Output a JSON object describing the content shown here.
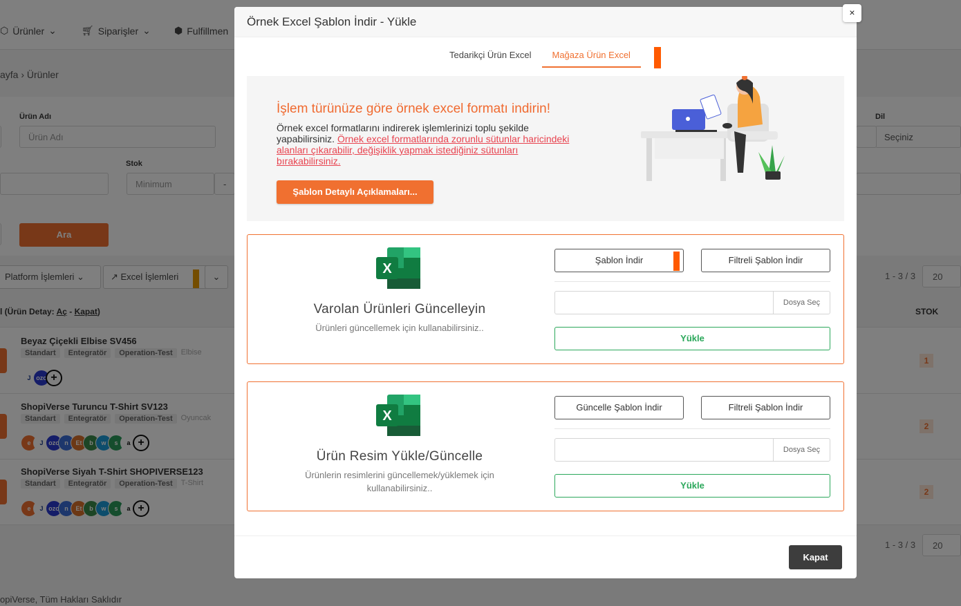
{
  "background": {
    "nav": {
      "products": "Ürünler",
      "orders": "Siparişler",
      "fulfillment": "Fulfillmen"
    },
    "breadcrumb": "ayfa  ›  Ürünler",
    "filters": {
      "product_name_label": "Ürün Adı",
      "product_name_placeholder": "Ürün Adı",
      "stock_label": "Stok",
      "stock_min_placeholder": "Minimum",
      "stock_dash": "-",
      "lang_label": "Dil",
      "lang_value": "Seçiniz",
      "search_button": "Ara"
    },
    "toolbar": {
      "platform_ops": "Platform İşlemleri",
      "excel_ops": "Excel İşlemleri",
      "pager_top": "1 - 3 / 3",
      "page_size": "20"
    },
    "table": {
      "head_detail_prefix": "l (Ürün Detay: ",
      "head_open": "Aç",
      "head_dash": " - ",
      "head_close": "Kapat",
      "head_end": ")",
      "head_stock": "STOK",
      "rows": [
        {
          "title": "Beyaz Çiçekli Elbise SV456",
          "tags": [
            "Standart",
            "Entegratör",
            "Operation-Test"
          ],
          "category": "Elbise",
          "stock": "1"
        },
        {
          "title": "ShopiVerse Turuncu T-Shirt SV123",
          "tags": [
            "Standart",
            "Entegratör",
            "Operation-Test"
          ],
          "category": "Oyuncak",
          "stock": "2"
        },
        {
          "title": "ShopiVerse Siyah T-Shirt SHOPIVERSE123",
          "tags": [
            "Standart",
            "Entegratör",
            "Operation-Test"
          ],
          "category": "T-Shirt",
          "stock": "2"
        }
      ]
    },
    "pager_bottom": "1 - 3 / 3",
    "page_size_bottom": "20",
    "footer": "opiVerse, Tüm Hakları Saklıdır"
  },
  "modal": {
    "title": "Örnek Excel Şablon İndir - Yükle",
    "close": "×",
    "tabs": [
      {
        "label": "Tedarikçi Ürün Excel",
        "active": false
      },
      {
        "label": "Mağaza Ürün Excel",
        "active": true
      }
    ],
    "info": {
      "title": "İşlem türünüze göre örnek excel formatı indirin!",
      "text": "Örnek excel formatlarını indirerek işlemlerinizi toplu şekilde yapabilirsiniz. ",
      "link": "Örnek excel formatlarında zorunlu sütunlar haricindeki alanları çıkarabilir, değişiklik yapmak istediğiniz sütunları bırakabilirsiniz.",
      "button": "Şablon Detaylı Açıklamaları..."
    },
    "card1": {
      "title": "Varolan Ürünleri Güncelleyin",
      "subtitle": "Ürünleri güncellemek için kullanabilirsiniz..",
      "download": "Şablon İndir",
      "filtered_download": "Filtreli Şablon İndir",
      "file_choose": "Dosya Seç",
      "upload": "Yükle"
    },
    "card2": {
      "title": "Ürün Resim Yükle/Güncelle",
      "subtitle": "Ürünlerin resimlerini güncellemek/yüklemek için kullanabilirsiniz..",
      "download": "Güncelle Şablon İndir",
      "filtered_download": "Filtreli Şablon İndir",
      "file_choose": "Dosya Seç",
      "upload": "Yükle"
    },
    "close_button": "Kapat"
  },
  "colors": {
    "accent": "#f07030",
    "green": "#2aa75a",
    "link": "#e8434f",
    "marker": "#ff5a00"
  }
}
